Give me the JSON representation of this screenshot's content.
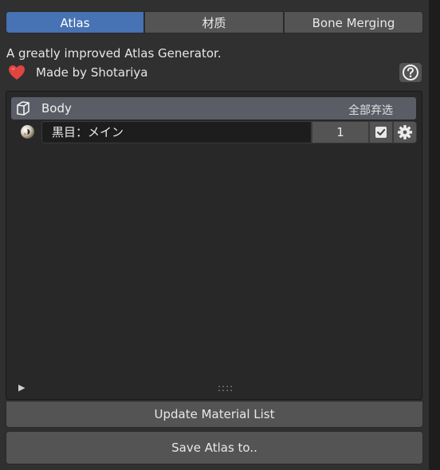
{
  "tabs": [
    {
      "label": "Atlas",
      "active": true
    },
    {
      "label": "材质",
      "active": false
    },
    {
      "label": "Bone Merging",
      "active": false
    }
  ],
  "description": "A greatly improved Atlas Generator.",
  "credit": "Made by Shotariya",
  "icons": {
    "heart": "heart-icon",
    "help": "help-icon",
    "object": "cube-icon",
    "material": "material-sphere-icon",
    "checkbox": "checkbox-icon",
    "settings": "gear-icon"
  },
  "list": {
    "group": {
      "label": "Body",
      "action": "全部弃选"
    },
    "items": [
      {
        "name": "黒目：メイン",
        "value": "1",
        "checked": true
      }
    ],
    "grip": "::::"
  },
  "buttons": {
    "update": "Update Material List",
    "save": "Save Atlas to.."
  },
  "colors": {
    "accent": "#4772b3",
    "button": "#545454",
    "panel": "#303030",
    "heart": "#e0453f"
  }
}
